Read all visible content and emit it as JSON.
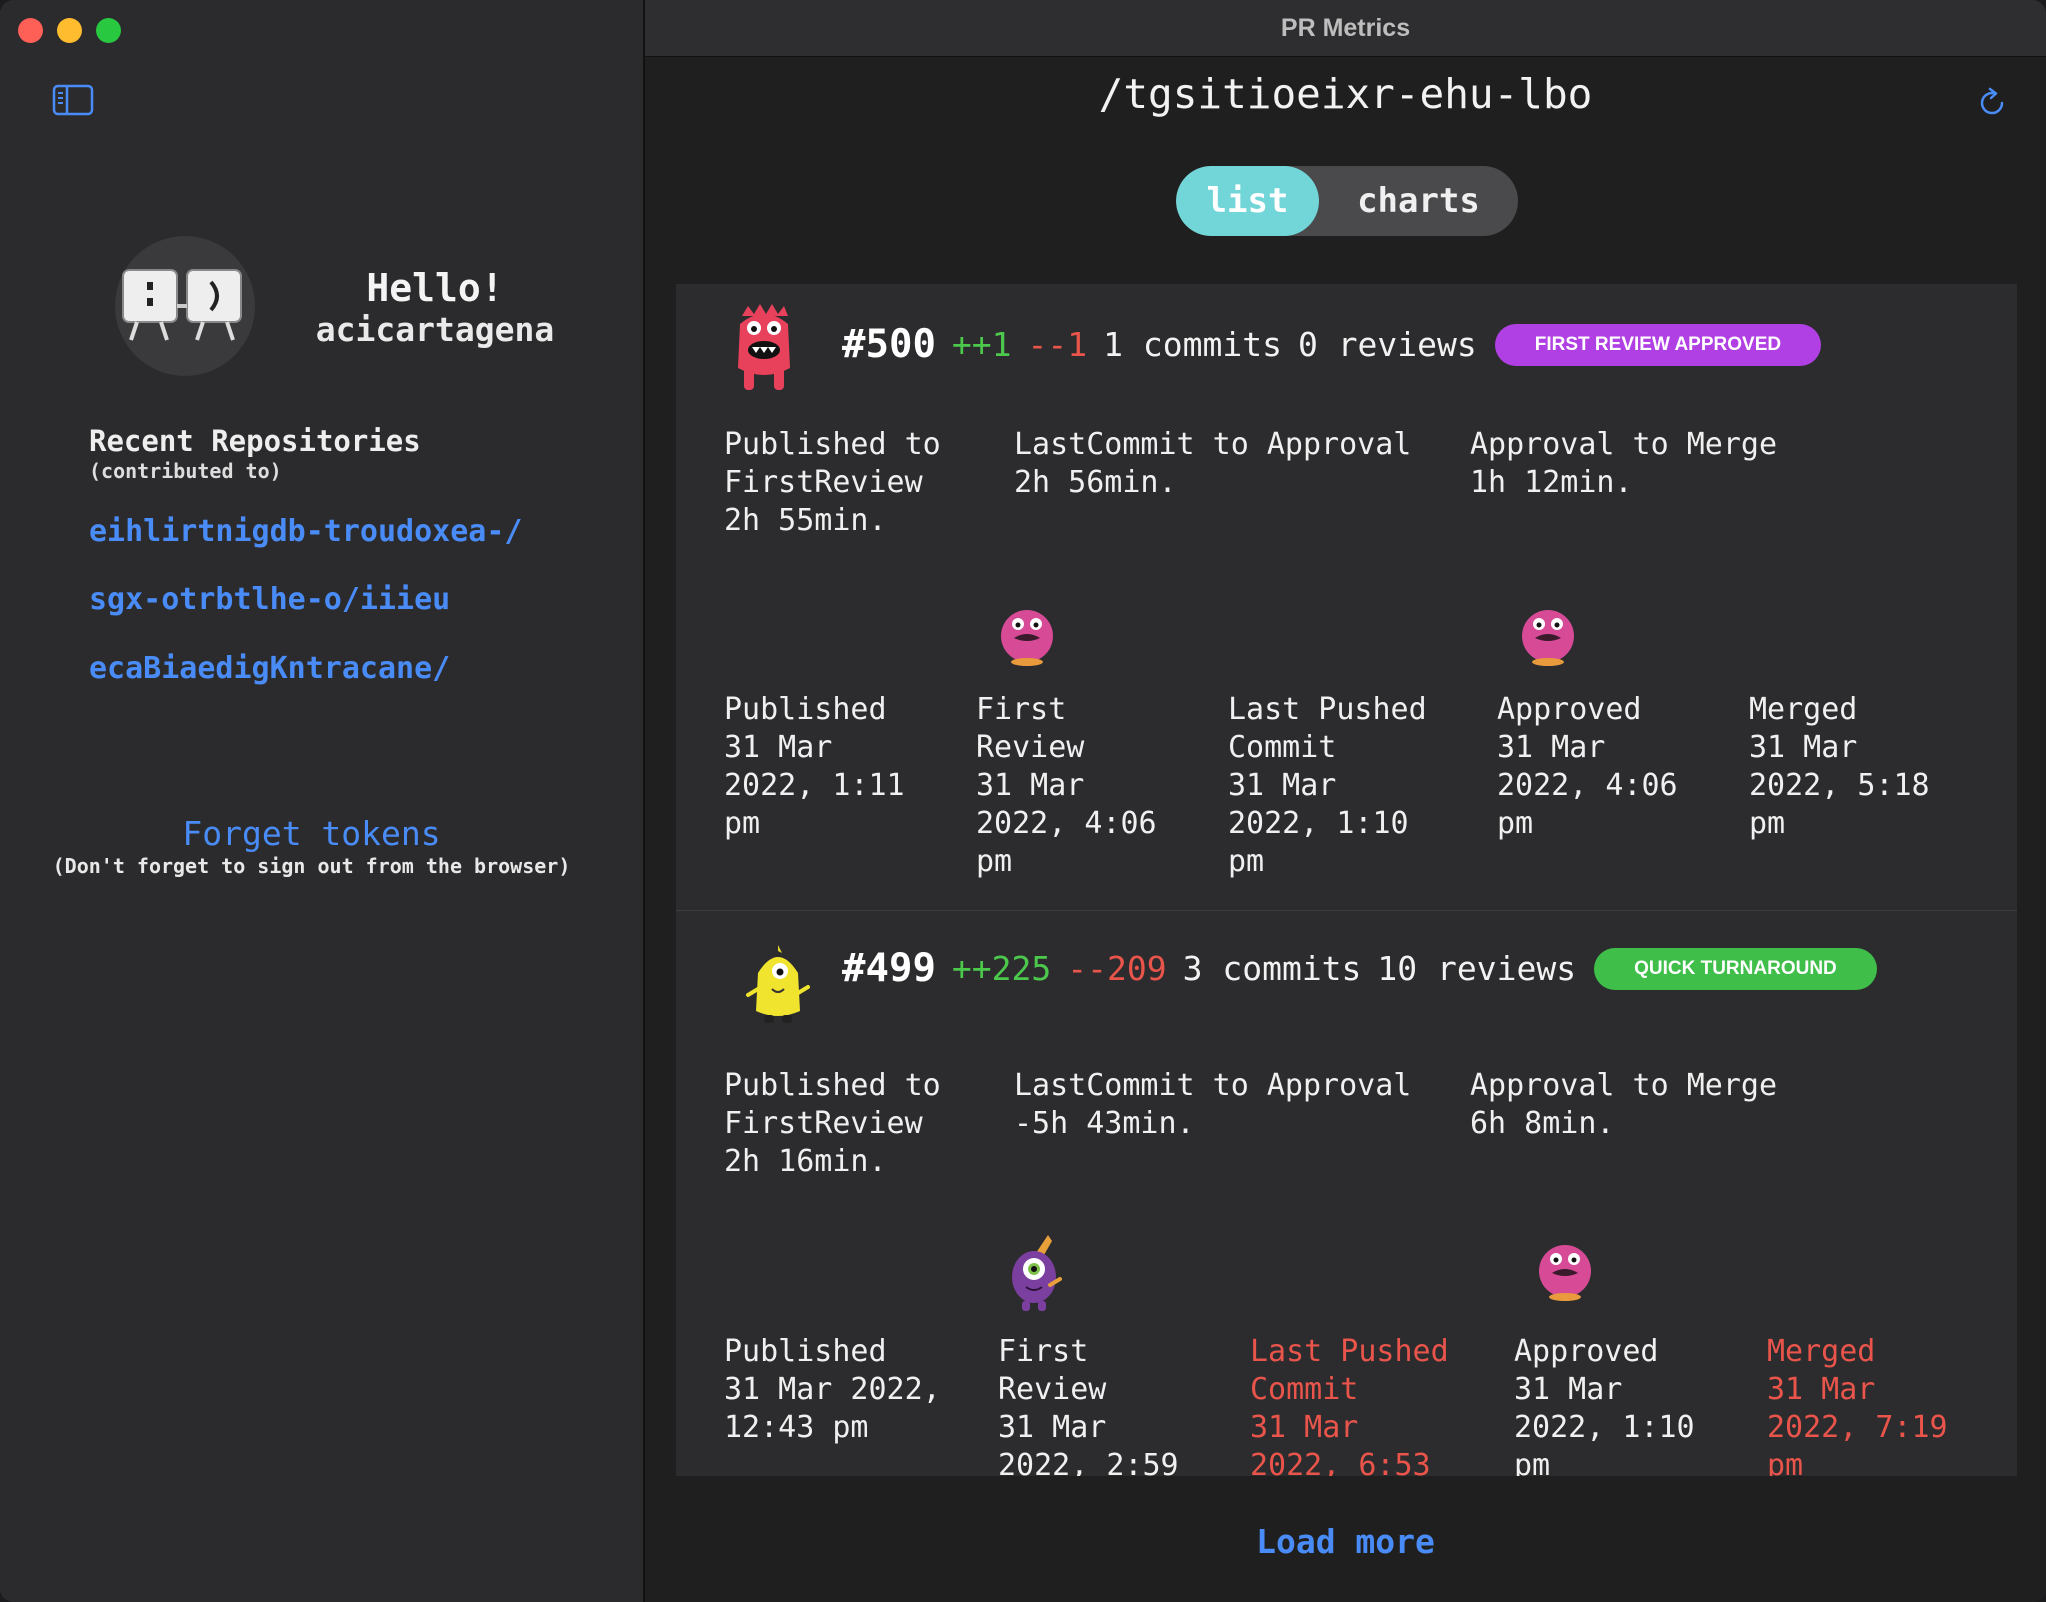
{
  "window": {
    "title": "PR Metrics"
  },
  "sidebar": {
    "greeting": "Hello!",
    "username": "acicartagena",
    "recent_title": "Recent Repositories",
    "recent_subtitle": "(contributed to)",
    "repos": [
      "eihlirtnigdb-troudoxea-/",
      "sgx-otrbtlhe-o/iiieu",
      "ecaBiaedigKntracane/"
    ],
    "forget_label": "Forget tokens",
    "forget_note": "(Don't forget to sign out from the browser)"
  },
  "main": {
    "repo_title": "/tgsitioeixr-ehu-lbo",
    "tabs": [
      {
        "label": "list",
        "active": true
      },
      {
        "label": "charts",
        "active": false
      }
    ],
    "load_more": "Load more",
    "prs": [
      {
        "number": "#500",
        "additions": "++1",
        "deletions": "--1",
        "commits": "1 commits",
        "reviews": "0 reviews",
        "badge": "FIRST REVIEW APPROVED",
        "badge_color": "#b040e3",
        "metrics": [
          "Published to\nFirstReview\n2h 55min.",
          "LastCommit to Approval\n2h 56min.",
          "Approval to Merge\n1h 12min."
        ],
        "timeline": [
          "Published\n31 Mar\n2022, 1:11\npm",
          "First\nReview\n31 Mar\n2022, 4:06\npm",
          "Last Pushed\nCommit\n31 Mar\n2022, 1:10\npm",
          "Approved\n31 Mar\n2022, 4:06\npm",
          "Merged\n31 Mar\n2022, 5:18\npm"
        ]
      },
      {
        "number": "#499",
        "additions": "++225",
        "deletions": "--209",
        "commits": "3 commits",
        "reviews": "10 reviews",
        "badge": "QUICK TURNAROUND",
        "badge_color": "#3fbf4a",
        "metrics": [
          "Published to\nFirstReview\n2h 16min.",
          "LastCommit to Approval\n-5h 43min.",
          "Approval to Merge\n6h 8min."
        ],
        "timeline": [
          "Published\n31 Mar 2022,\n12:43 pm",
          "First\nReview\n31 Mar\n2022, 2:59",
          "Last Pushed\nCommit\n31 Mar\n2022, 6:53",
          "Approved\n31 Mar\n2022, 1:10\npm",
          "Merged\n31 Mar\n2022, 7:19\npm"
        ]
      }
    ]
  },
  "colors": {
    "accent": "#4a8cf7",
    "segment_active": "#72d6d9",
    "additions": "#4cc94c",
    "deletions": "#e9544b"
  }
}
